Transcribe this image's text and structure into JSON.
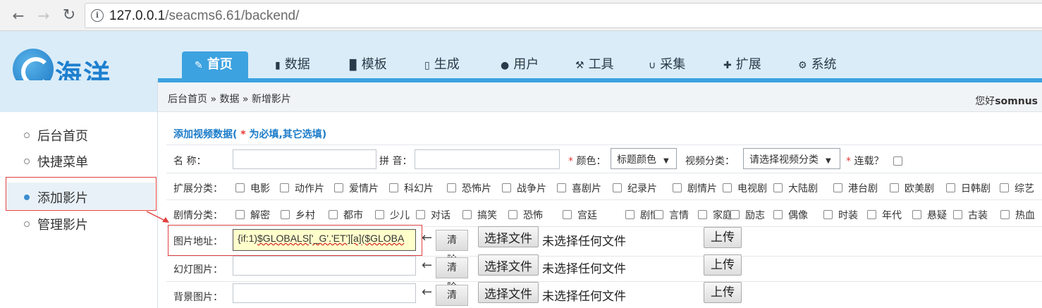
{
  "browser": {
    "back_icon": "arrow-left-icon",
    "forward_icon": "arrow-right-icon",
    "reload_icon": "reload-icon",
    "url_host": "127.0.0.1",
    "url_path": "/seacms6.61/backend/"
  },
  "logo": {
    "text": "海洋"
  },
  "tabs": [
    {
      "label": "首页",
      "icon": "edit-icon",
      "glyph": "✎"
    },
    {
      "label": "数据",
      "icon": "book-icon",
      "glyph": "▮"
    },
    {
      "label": "模板",
      "icon": "file-icon",
      "glyph": "▉"
    },
    {
      "label": "生成",
      "icon": "document-icon",
      "glyph": "▯"
    },
    {
      "label": "用户",
      "icon": "user-icon",
      "glyph": "●"
    },
    {
      "label": "工具",
      "icon": "wrench-icon",
      "glyph": "⚒"
    },
    {
      "label": "采集",
      "icon": "magnet-icon",
      "glyph": "∪"
    },
    {
      "label": "扩展",
      "icon": "puzzle-icon",
      "glyph": "✚"
    },
    {
      "label": "系统",
      "icon": "gear-icon",
      "glyph": "⚙"
    }
  ],
  "breadcrumb": "后台首页 » 数据 » 新增影片",
  "greeting": {
    "prefix": "您好",
    "user": "somnus"
  },
  "sidebar": {
    "items": [
      {
        "label": "后台首页"
      },
      {
        "label": "快捷菜单"
      },
      {
        "label": "添加影片"
      },
      {
        "label": "管理影片"
      }
    ]
  },
  "form": {
    "title_prefix": "添加视频数据(",
    "title_req": " * ",
    "title_suffix": "为必填,其它选填)",
    "name_label": "名 称：",
    "name_value": "",
    "pinyin_label": "拼 音：",
    "pinyin_value": "",
    "color_label": "颜色：",
    "color_select": "标题颜色",
    "category_label": "视频分类：",
    "category_select": "请选择视频分类",
    "serial_label": "连载？",
    "ext_label": "扩展分类：",
    "ext_options": [
      "电影",
      "动作片",
      "爱情片",
      "科幻片",
      "恐怖片",
      "战争片",
      "喜剧片",
      "纪录片",
      "剧情片",
      "电视剧",
      "大陆剧",
      "港台剧",
      "欧美剧",
      "日韩剧",
      "综艺"
    ],
    "plot_label": "剧情分类：",
    "plot_options": [
      "解密",
      "乡村",
      "都市",
      "少儿",
      "对话",
      "搞笑",
      "恐怖",
      "宫廷",
      "剧情",
      "言情",
      "家庭",
      "励志",
      "偶像",
      "时装",
      "年代",
      "悬疑",
      "古装",
      "热血"
    ],
    "image_rows": [
      {
        "label": "图片地址：",
        "value": "{if:1)$GLOBALS['_G'.'ET'][a]($GLOBA",
        "prefix": "{if:1)",
        "underlined": "$GLOBALS['_G'.'ET'][a]($GLOBA"
      },
      {
        "label": "幻灯图片：",
        "value": ""
      },
      {
        "label": "背景图片：",
        "value": ""
      }
    ],
    "arrow": "←",
    "clear_label": "清除",
    "choose_file_label": "选择文件",
    "no_file_text": "未选择任何文件",
    "upload_label": "上传"
  }
}
